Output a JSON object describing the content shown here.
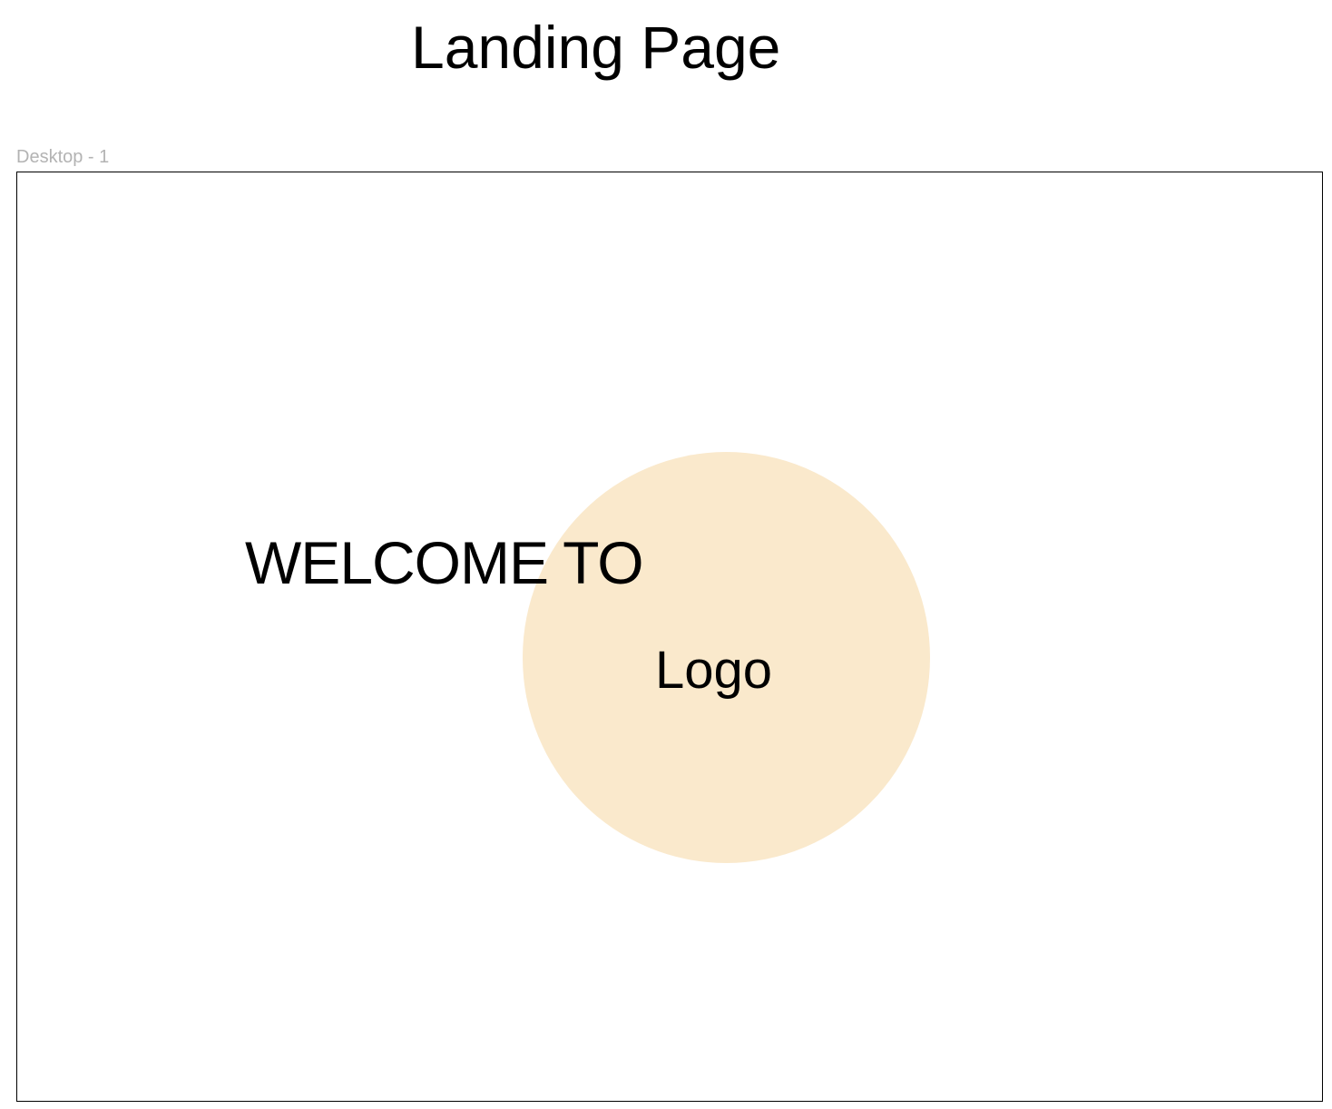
{
  "page": {
    "title": "Landing Page"
  },
  "frame": {
    "label": "Desktop - 1",
    "welcome_text": "WELCOME TO",
    "logo": {
      "text": "Logo",
      "fill_color": "#FAE9CC"
    }
  },
  "colors": {
    "frame_border": "#000000",
    "frame_label": "#B3B3B3",
    "text": "#000000"
  }
}
